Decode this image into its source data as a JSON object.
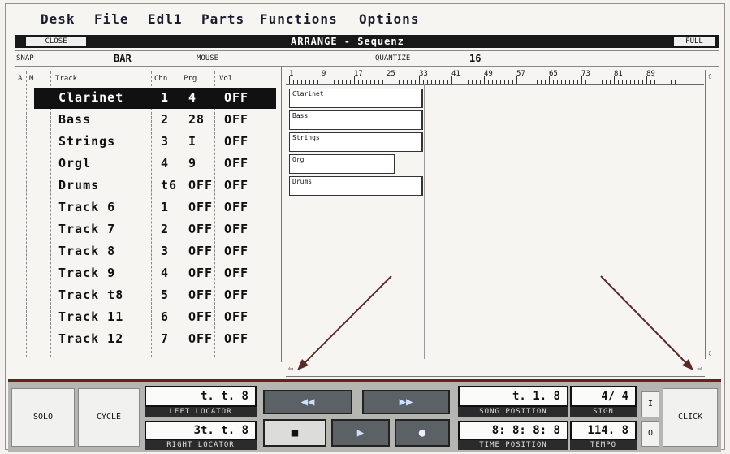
{
  "menu": {
    "items": [
      "Desk",
      "File",
      "Edl1",
      "Parts",
      "Functions",
      "Options"
    ]
  },
  "window": {
    "close_label": "CLOSE",
    "title": "ARRANGE  -  Sequenz",
    "full_label": "FULL"
  },
  "info": {
    "snap_label": "SNAP",
    "snap_value": "BAR",
    "mouse_label": "MOUSE",
    "quantize_label": "QUANTIZE",
    "quantize_value": "16"
  },
  "track_columns": {
    "a": "A",
    "m": "M",
    "track": "Track",
    "chn": "Chn",
    "prg": "Prg",
    "vol": "Vol"
  },
  "tracks": [
    {
      "name": "Clarinet",
      "chn": "1",
      "prg": "4",
      "vol": "OFF",
      "selected": true
    },
    {
      "name": "Bass",
      "chn": "2",
      "prg": "28",
      "vol": "OFF"
    },
    {
      "name": "Strings",
      "chn": "3",
      "prg": "I",
      "vol": "OFF"
    },
    {
      "name": "Orgl",
      "chn": "4",
      "prg": "9",
      "vol": "OFF"
    },
    {
      "name": "Drums",
      "chn": "t6",
      "prg": "OFF",
      "vol": "OFF"
    },
    {
      "name": "Track 6",
      "chn": "1",
      "prg": "OFF",
      "vol": "OFF"
    },
    {
      "name": "Track 7",
      "chn": "2",
      "prg": "OFF",
      "vol": "OFF"
    },
    {
      "name": "Track 8",
      "chn": "3",
      "prg": "OFF",
      "vol": "OFF"
    },
    {
      "name": "Track 9",
      "chn": "4",
      "prg": "OFF",
      "vol": "OFF"
    },
    {
      "name": "Track t8",
      "chn": "5",
      "prg": "OFF",
      "vol": "OFF"
    },
    {
      "name": "Track 11",
      "chn": "6",
      "prg": "OFF",
      "vol": "OFF"
    },
    {
      "name": "Track 12",
      "chn": "7",
      "prg": "OFF",
      "vol": "OFF"
    }
  ],
  "ruler": {
    "numbers": [
      "1",
      "9",
      "17",
      "25",
      "33",
      "41",
      "49",
      "57",
      "65",
      "73",
      "81",
      "89"
    ]
  },
  "parts": [
    {
      "label": "Clarinet"
    },
    {
      "label": "Bass"
    },
    {
      "label": "Strings"
    },
    {
      "label": "Org"
    },
    {
      "label": "Drums"
    }
  ],
  "transport": {
    "solo_label": "SOLO",
    "cycle_label": "CYCLE",
    "left_locator_value": "t.  t.   8",
    "left_locator_label": "LEFT LOCATOR",
    "right_locator_value": "3t.  t.   8",
    "right_locator_label": "RIGHT LOCATOR",
    "song_position_value": "t.  1.   8",
    "song_position_label": "SONG POSITION",
    "time_position_value": "8: 8: 8: 8",
    "time_position_label": "TIME POSITION",
    "sign_value": "4/ 4",
    "sign_label": "SIGN",
    "tempo_value": "114.   8",
    "tempo_label": "TEMPO",
    "side_top": "I",
    "side_bottom": "O",
    "click_label": "CLICK"
  },
  "colors": {
    "accent": "#6a1f20",
    "panel": "#b5b5b2",
    "key": "#5c6166"
  }
}
